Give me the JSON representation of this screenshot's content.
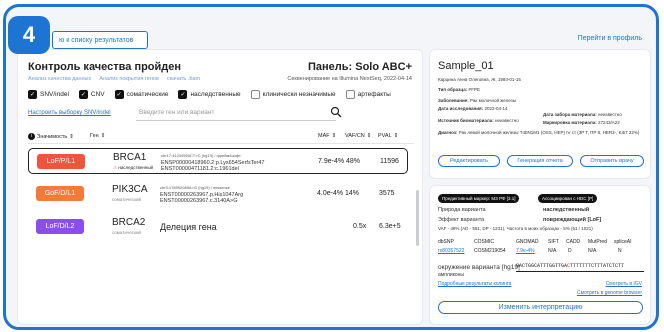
{
  "step": "4",
  "topbar": {
    "back_label": "ю к списку результатов",
    "profile_link": "Перейти в профиль"
  },
  "left": {
    "title": "Контроль качества пройден",
    "links": [
      "Анализ качества данных",
      "Анализ покрытия генов",
      "скачать .bam"
    ],
    "panel_title": "Панель: Solo ABC+",
    "panel_sub": "Секвенирование на Illumina NextSeq, 2022-04-14",
    "filters": [
      {
        "label": "SNV/indel",
        "checked": true
      },
      {
        "label": "CNV",
        "checked": true
      },
      {
        "label": "соматические",
        "checked": true
      },
      {
        "label": "наследственные",
        "checked": true
      },
      {
        "label": "клинически незначимые",
        "checked": false
      },
      {
        "label": "артефакты",
        "checked": false
      }
    ],
    "select_filter": "Настроить выборку SNV/indel",
    "search_placeholder": "Введите ген или вариант",
    "headers": {
      "significance": "Значимость",
      "gene": "Ген",
      "maf": "MAF",
      "vafcn": "VAF/CN",
      "pval": "PVAL"
    },
    "rows": [
      {
        "tag": "LoF/P/L1",
        "tag_color": "#f0543c",
        "gene": "BRCA1",
        "gsub": "наследственный",
        "hgvs_small": "chr17:41234560CT>C (hg19) / фрейм/шифт",
        "hgvs1": "ENSP00000418960.2:p.Lys654SerfsTer47",
        "hgvs2": "ENST00000471181.2:c.1961del",
        "maf": "7.9e-4%",
        "vaf": "48%",
        "pval": "11596"
      },
      {
        "tag": "GoF/D/L1",
        "tag_color": "#f47a3a",
        "gene": "PIK3CA",
        "gsub": "соматический",
        "hgvs_small": "chr3:178952085A>G (hg19) / missense",
        "hgvs1": "ENST00000263967.p.His1047Arg",
        "hgvs2": "ENST00000263967.c.3140A>G",
        "maf": "4.0e-4%",
        "vaf": "14%",
        "pval": "3575"
      },
      {
        "tag": "LoF/D/L2",
        "tag_color": "#8a4fe8",
        "gene": "BRCA2",
        "gsub": "соматический",
        "deletion": "Делеция гена",
        "maf": "",
        "vaf": "0.5x",
        "pval": "6.3e+5"
      }
    ]
  },
  "sample": {
    "title": "Sample_01",
    "patient": "Карцина Анна Олеговна, Ж, 1993-01-15",
    "type_label": "Тип образца:",
    "type_val": "FFPE",
    "disease_label": "Заболевание:",
    "disease_val": "Рак молочной железы",
    "study_date_label": "Дата исследования:",
    "study_date_val": "2022-04-14",
    "collect_label": "Дата забора материала:",
    "collect_val": "неизвестно",
    "source_label": "Источник биоматериала:",
    "source_val": "неизвестно",
    "marker_label": "Маркировка материала:",
    "marker_val": "27243/A22",
    "diag_label": "Диагноз:",
    "diag_val": "Рак левой молочной железы T4bN1M1 (OSS, HEP) IV ст (3P T, ПР 8, HER2-, Ki67 22%)",
    "btn_edit": "Редактировать",
    "btn_report": "Генерация отчета",
    "btn_send": "Отправить врачу"
  },
  "variant": {
    "pill1": "Предиктивный маркер: МЗ РФ [3.1]",
    "pill2": "Ассоциирован с HDC [P]",
    "nature_label": "Природа варианта",
    "nature_val": "наследственный",
    "effect_label": "Эффект варианта",
    "effect_val": "повреждающий [LoF]",
    "vaf_line": "VAF - 48% (AD - 591, DP - 1231), Частота в моих образцах - 5% (51 / 1021)",
    "grid_headers": [
      "dbSNP",
      "COSMIC",
      "GNOMAD",
      "SIFT",
      "CADD",
      "MutPred",
      "spliceAI"
    ],
    "grid_values": [
      "rs80357522",
      "COSM219054",
      "7.9e-4%",
      "N/A",
      "D",
      "N/A",
      "N"
    ],
    "context_label": "окружение варианта [hg19]",
    "amplicon_label": "ампликоны",
    "seq_left": "GACTGGCATTTGGTTGA",
    "seq_red": "C",
    "seq_right": "TTTTTTTCTTTATCTCTT",
    "link_console": "Подробные результаты колинга",
    "link_igv": "Смотреть в IGV",
    "link_genome": "Смотреть в genome browser",
    "btn_change": "Изменить интерпретацию"
  }
}
